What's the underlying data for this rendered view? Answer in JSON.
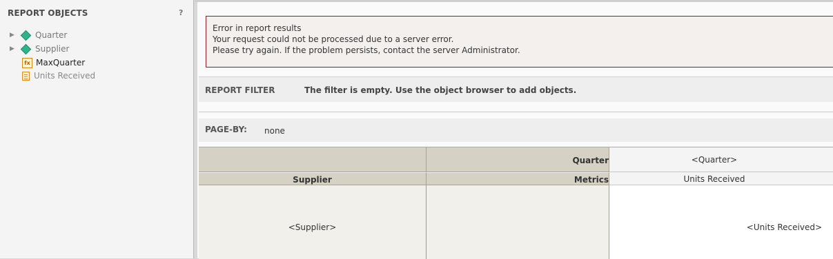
{
  "left_panel": {
    "title": "REPORT OBJECTS",
    "help": "?",
    "items": [
      {
        "label": "Quarter",
        "icon": "attribute-icon",
        "expandable": true
      },
      {
        "label": "Supplier",
        "icon": "attribute-icon",
        "expandable": true
      },
      {
        "label": "MaxQuarter",
        "icon": "function-icon",
        "expandable": false
      },
      {
        "label": "Units Received",
        "icon": "metric-icon",
        "expandable": false
      }
    ]
  },
  "error": {
    "line1": "Error in report results",
    "line2": "Your request could not be processed due to a server error.",
    "line3": "Please try again. If the problem persists, contact the server Administrator."
  },
  "report_filter": {
    "label": "REPORT FILTER",
    "message": "The filter is empty. Use the object browser to add objects."
  },
  "page_by": {
    "label": "PAGE-BY:",
    "value": "none"
  },
  "grid": {
    "quarter_header": "Quarter",
    "quarter_value": "<Quarter>",
    "supplier_header": "Supplier",
    "metrics_header": "Metrics",
    "metric_name": "Units Received",
    "supplier_value": "<Supplier>",
    "metric_value": "<Units Received>"
  },
  "colors": {
    "error_border": "#8a1f2a",
    "header_bg": "#d6d1c5",
    "attribute_icon": "#2fb38b",
    "metric_icon": "#e08a1b"
  }
}
